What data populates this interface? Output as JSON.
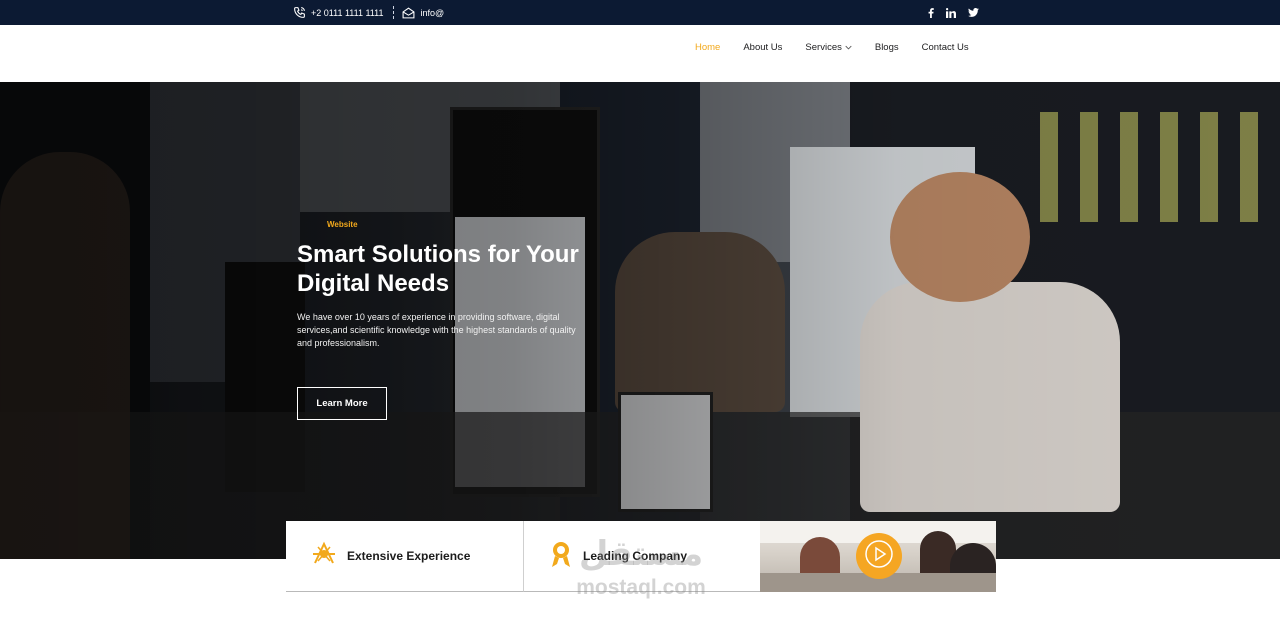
{
  "topbar": {
    "phone": "+2 0111 1111  1111",
    "email": "info@",
    "social": [
      "facebook-icon",
      "linkedin-icon",
      "twitter-icon"
    ]
  },
  "nav": {
    "items": [
      {
        "label": "Home",
        "active": true
      },
      {
        "label": "About Us"
      },
      {
        "label": "Services",
        "has_dropdown": true
      },
      {
        "label": "Blogs"
      },
      {
        "label": "Contact Us"
      }
    ]
  },
  "hero": {
    "eyebrow": "Website",
    "title": "Smart Solutions for Your Digital Needs",
    "description": "We have over 10 years of experience in providing software, digital services,and scientific knowledge with the highest standards of quality and professionalism.",
    "button_label": "Learn More"
  },
  "features": [
    {
      "label": "Extensive Experience",
      "icon": "sparkle-icon"
    },
    {
      "label": "Leading Company",
      "icon": "award-icon"
    }
  ],
  "video": {
    "icon": "play-icon"
  },
  "watermark": {
    "arabic": "مستقل",
    "latin": "mostaql.com"
  },
  "colors": {
    "accent": "#f2a91c",
    "topbar": "#0c1a33",
    "text": "#1d1d1f"
  }
}
